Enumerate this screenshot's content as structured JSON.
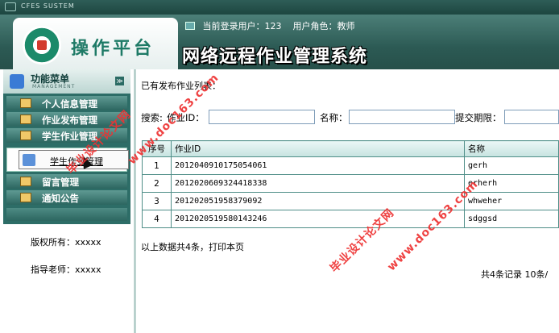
{
  "titlebar": {
    "system_label": "CFES SUSTEM"
  },
  "header": {
    "logo_text": "操作平台",
    "login_label": "当前登录用户：123",
    "role_label": "用户角色：教师",
    "app_title": "网络远程作业管理系统"
  },
  "sidebar": {
    "menu_title": "功能菜单",
    "menu_subtitle": "MANAGEMENT",
    "toggle_glyph": "≫",
    "items": [
      {
        "label": "个人信息管理"
      },
      {
        "label": "作业发布管理"
      },
      {
        "label": "学生作业管理"
      },
      {
        "label": "留言管理"
      },
      {
        "label": "通知公告"
      }
    ],
    "sub_item": {
      "label": "学生作业管理"
    },
    "copyright": "版权所有：xxxxx",
    "teacher": "指导老师：xxxxx"
  },
  "main": {
    "title": "已有发布作业列表：",
    "search": {
      "label": "搜索:",
      "id_label": "作业ID：",
      "id_value": "",
      "name_label": "名称：",
      "name_value": "",
      "deadline_label": "提交期限：",
      "deadline_value": ""
    },
    "table": {
      "headers": [
        "序号",
        "作业ID",
        "名称"
      ],
      "rows": [
        [
          "1",
          "2012040910175054061",
          "gerh"
        ],
        [
          "2",
          "2012020609324418338",
          "erherh"
        ],
        [
          "3",
          "201202051958379092",
          "whweher"
        ],
        [
          "4",
          "2012020519580143246",
          "sdggsd"
        ]
      ]
    },
    "summary": "以上数据共4条，打印本页",
    "pager": "共4条记录   10条/"
  },
  "watermarks": {
    "text_a": "毕业设计论文网",
    "text_b": "www.doc163.com"
  },
  "colors": {
    "header_dark": "#2c5a54",
    "menu_item": "#2c6660",
    "table_border": "#4f8e88",
    "watermark": "#ee3333"
  }
}
